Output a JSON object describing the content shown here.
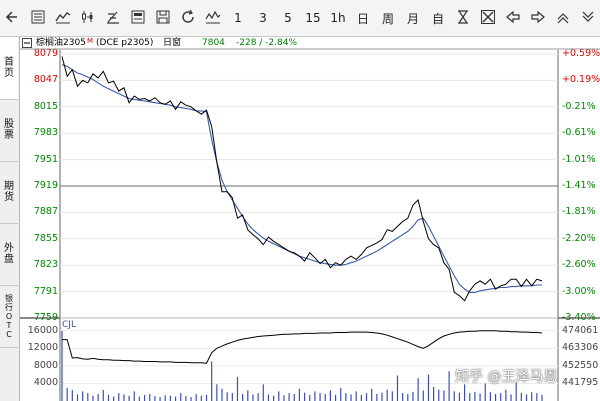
{
  "toolbar": {
    "buttons": [
      {
        "name": "back-button",
        "icon": "arrow-left-icon"
      },
      {
        "name": "table-view-button",
        "icon": "table-icon"
      },
      {
        "name": "line-chart-button",
        "icon": "line-chart-icon"
      },
      {
        "name": "kline-button",
        "icon": "candlestick-icon"
      },
      {
        "name": "draw-tool-button",
        "icon": "draw-icon"
      },
      {
        "name": "stock-select-button",
        "icon": "list-box-icon"
      },
      {
        "name": "save-button",
        "icon": "save-icon"
      },
      {
        "name": "refresh-button",
        "icon": "refresh-icon"
      },
      {
        "name": "indicator-button",
        "icon": "zigzag-icon"
      }
    ],
    "periods": [
      "1",
      "3",
      "5",
      "15",
      "1h",
      "日",
      "周",
      "月",
      "自"
    ],
    "right_buttons": [
      {
        "name": "zoom-fit-button",
        "icon": "hourglass-icon"
      },
      {
        "name": "cross-cursor-button",
        "icon": "crosshair-icon"
      },
      {
        "name": "prev-button",
        "icon": "arrow-left-solid-icon"
      },
      {
        "name": "next-button",
        "icon": "arrow-right-solid-icon"
      },
      {
        "name": "zoom-out-button",
        "icon": "chevron-up-icon"
      },
      {
        "name": "more-button",
        "icon": "chevron-down-icon"
      }
    ]
  },
  "sidebar": {
    "tabs": [
      {
        "label": [
          "首",
          "页"
        ]
      },
      {
        "label": [
          "股",
          "票"
        ]
      },
      {
        "label": [
          "期",
          "货"
        ]
      },
      {
        "label": [
          "外",
          "盘"
        ]
      },
      {
        "label": [
          "银",
          "行",
          "O",
          "T",
          "C"
        ]
      }
    ]
  },
  "header": {
    "icon": "minus-box-icon",
    "symbol": "棕榈油2305",
    "marker": "M",
    "code": "(DCE p2305)",
    "window": "日窗",
    "price": "7804",
    "change": "-228 / -2.84%",
    "colors": {
      "symbol": "#000000",
      "marker": "#ff0000",
      "price": "#008000",
      "change": "#008000"
    }
  },
  "price_axis": [
    {
      "price": "8079",
      "pct": "+0.59%",
      "color": "#e00000"
    },
    {
      "price": "8047",
      "pct": "+0.19%",
      "color": "#e00000"
    },
    {
      "price": "8015",
      "pct": "-0.21%",
      "color": "#008800"
    },
    {
      "price": "7983",
      "pct": "-0.61%",
      "color": "#008800"
    },
    {
      "price": "7951",
      "pct": "-1.01%",
      "color": "#008800"
    },
    {
      "price": "7919",
      "pct": "-1.41%",
      "color": "#008800"
    },
    {
      "price": "7887",
      "pct": "-1.81%",
      "color": "#008800"
    },
    {
      "price": "7855",
      "pct": "-2.20%",
      "color": "#008800"
    },
    {
      "price": "7823",
      "pct": "-2.60%",
      "color": "#008800"
    },
    {
      "price": "7791",
      "pct": "-3.00%",
      "color": "#008800"
    },
    {
      "price": "7759",
      "pct": "-3.40%",
      "color": "#008800"
    }
  ],
  "volume_label": "CJL",
  "volume_axis": {
    "left": [
      "16000",
      "12000",
      "8000",
      "4000"
    ],
    "right": [
      "474061",
      "463306",
      "452550",
      "441795"
    ]
  },
  "watermark": "知乎 @王泽马恩",
  "chart_data": {
    "type": "line",
    "ylim": [
      7759,
      8079
    ],
    "series": [
      {
        "values": [
          8076,
          8052,
          8060,
          8040,
          8047,
          8044,
          8055,
          8050,
          8058,
          8044,
          8046,
          8034,
          8038,
          8020,
          8028,
          8024,
          8025,
          8022,
          8026,
          8020,
          8018,
          8022,
          8012,
          8021,
          8017,
          8015,
          8010,
          8006,
          8011,
          7991,
          7948,
          7912,
          7912,
          7905,
          7880,
          7884,
          7866,
          7860,
          7855,
          7848,
          7857,
          7852,
          7848,
          7844,
          7840,
          7838,
          7834,
          7828,
          7838,
          7832,
          7825,
          7830,
          7820,
          7826,
          7823,
          7830,
          7834,
          7830,
          7836,
          7844,
          7847,
          7850,
          7854,
          7866,
          7864,
          7870,
          7876,
          7880,
          7896,
          7902,
          7876,
          7855,
          7848,
          7844,
          7826,
          7818,
          7790,
          7786,
          7780,
          7792,
          7800,
          7804,
          7800,
          7806,
          7794,
          7798,
          7800,
          7806,
          7806,
          7797,
          7806,
          7798,
          7806,
          7804
        ],
        "color": "#000000"
      },
      {
        "values": [
          8066,
          8064,
          8060,
          8056,
          8054,
          8051,
          8048,
          8044,
          8040,
          8037,
          8034,
          8031,
          8028,
          8025,
          8024,
          8023,
          8022,
          8021,
          8020,
          8019,
          8018,
          8017,
          8015,
          8014,
          8013,
          8012,
          8010,
          8010,
          8009,
          7975,
          7948,
          7926,
          7912,
          7902,
          7892,
          7882,
          7873,
          7866,
          7861,
          7856,
          7852,
          7849,
          7846,
          7843,
          7840,
          7837,
          7834,
          7832,
          7830,
          7828,
          7826,
          7825,
          7824,
          7823,
          7823,
          7824,
          7826,
          7828,
          7831,
          7834,
          7837,
          7840,
          7844,
          7848,
          7852,
          7856,
          7860,
          7864,
          7870,
          7878,
          7880,
          7870,
          7858,
          7846,
          7834,
          7822,
          7810,
          7800,
          7794,
          7790,
          7790,
          7792,
          7793,
          7794,
          7795,
          7796,
          7796,
          7797,
          7797,
          7798,
          7798,
          7798,
          7799,
          7799
        ],
        "color": "#3a5aa8"
      },
      {
        "values": [
          16000,
          3000,
          2500,
          1500,
          2200,
          1800,
          1200,
          1600,
          2500,
          1400,
          1000,
          1800,
          1500,
          1200,
          2200,
          1000,
          1400,
          1600,
          1100,
          900,
          1300,
          1200,
          1000,
          1800,
          1100,
          900,
          1600,
          1200,
          1400,
          9000,
          3800,
          2800,
          2000,
          1800,
          5500,
          1600,
          2400,
          1500,
          1800,
          3800,
          1500,
          1200,
          2200,
          1300,
          1800,
          1600,
          2800,
          1900,
          1400,
          2200,
          1800,
          1600,
          2400,
          1400,
          3000,
          1800,
          1500,
          2200,
          1400,
          1800,
          2800,
          1600,
          1900,
          2600,
          2200,
          5800,
          1800,
          1600,
          2100,
          5200,
          2400,
          6000,
          3200,
          2600,
          2400,
          6800,
          2200,
          1900,
          3800,
          1800,
          2100,
          1700,
          4000,
          2000,
          1600,
          1800,
          2600,
          1500,
          4200,
          1900,
          1500,
          2000,
          1800,
          1400
        ],
        "color": "#3a4ec2"
      },
      {
        "values": [
          14000,
          14000,
          9800,
          9900,
          9600,
          9500,
          9700,
          9500,
          9400,
          9400,
          9300,
          9300,
          9200,
          9200,
          9100,
          9100,
          9000,
          9000,
          9000,
          8900,
          8900,
          8900,
          8800,
          8800,
          8800,
          8700,
          8700,
          8700,
          8600,
          11000,
          12000,
          12500,
          13000,
          13400,
          13800,
          14100,
          14300,
          14500,
          14700,
          14800,
          14900,
          15000,
          15100,
          15200,
          15200,
          15300,
          15300,
          15400,
          15400,
          15400,
          15500,
          15500,
          15500,
          15600,
          15600,
          15600,
          15700,
          15700,
          15700,
          15700,
          15600,
          15500,
          15300,
          15000,
          14600,
          14200,
          13800,
          13400,
          12900,
          12400,
          12000,
          12600,
          13400,
          14200,
          14800,
          15200,
          15500,
          15700,
          15800,
          15900,
          15900,
          16000,
          16000,
          16000,
          16000,
          15900,
          15900,
          15800,
          15800,
          15700,
          15700,
          15600,
          15600,
          15500
        ],
        "color": "#000000"
      }
    ]
  }
}
